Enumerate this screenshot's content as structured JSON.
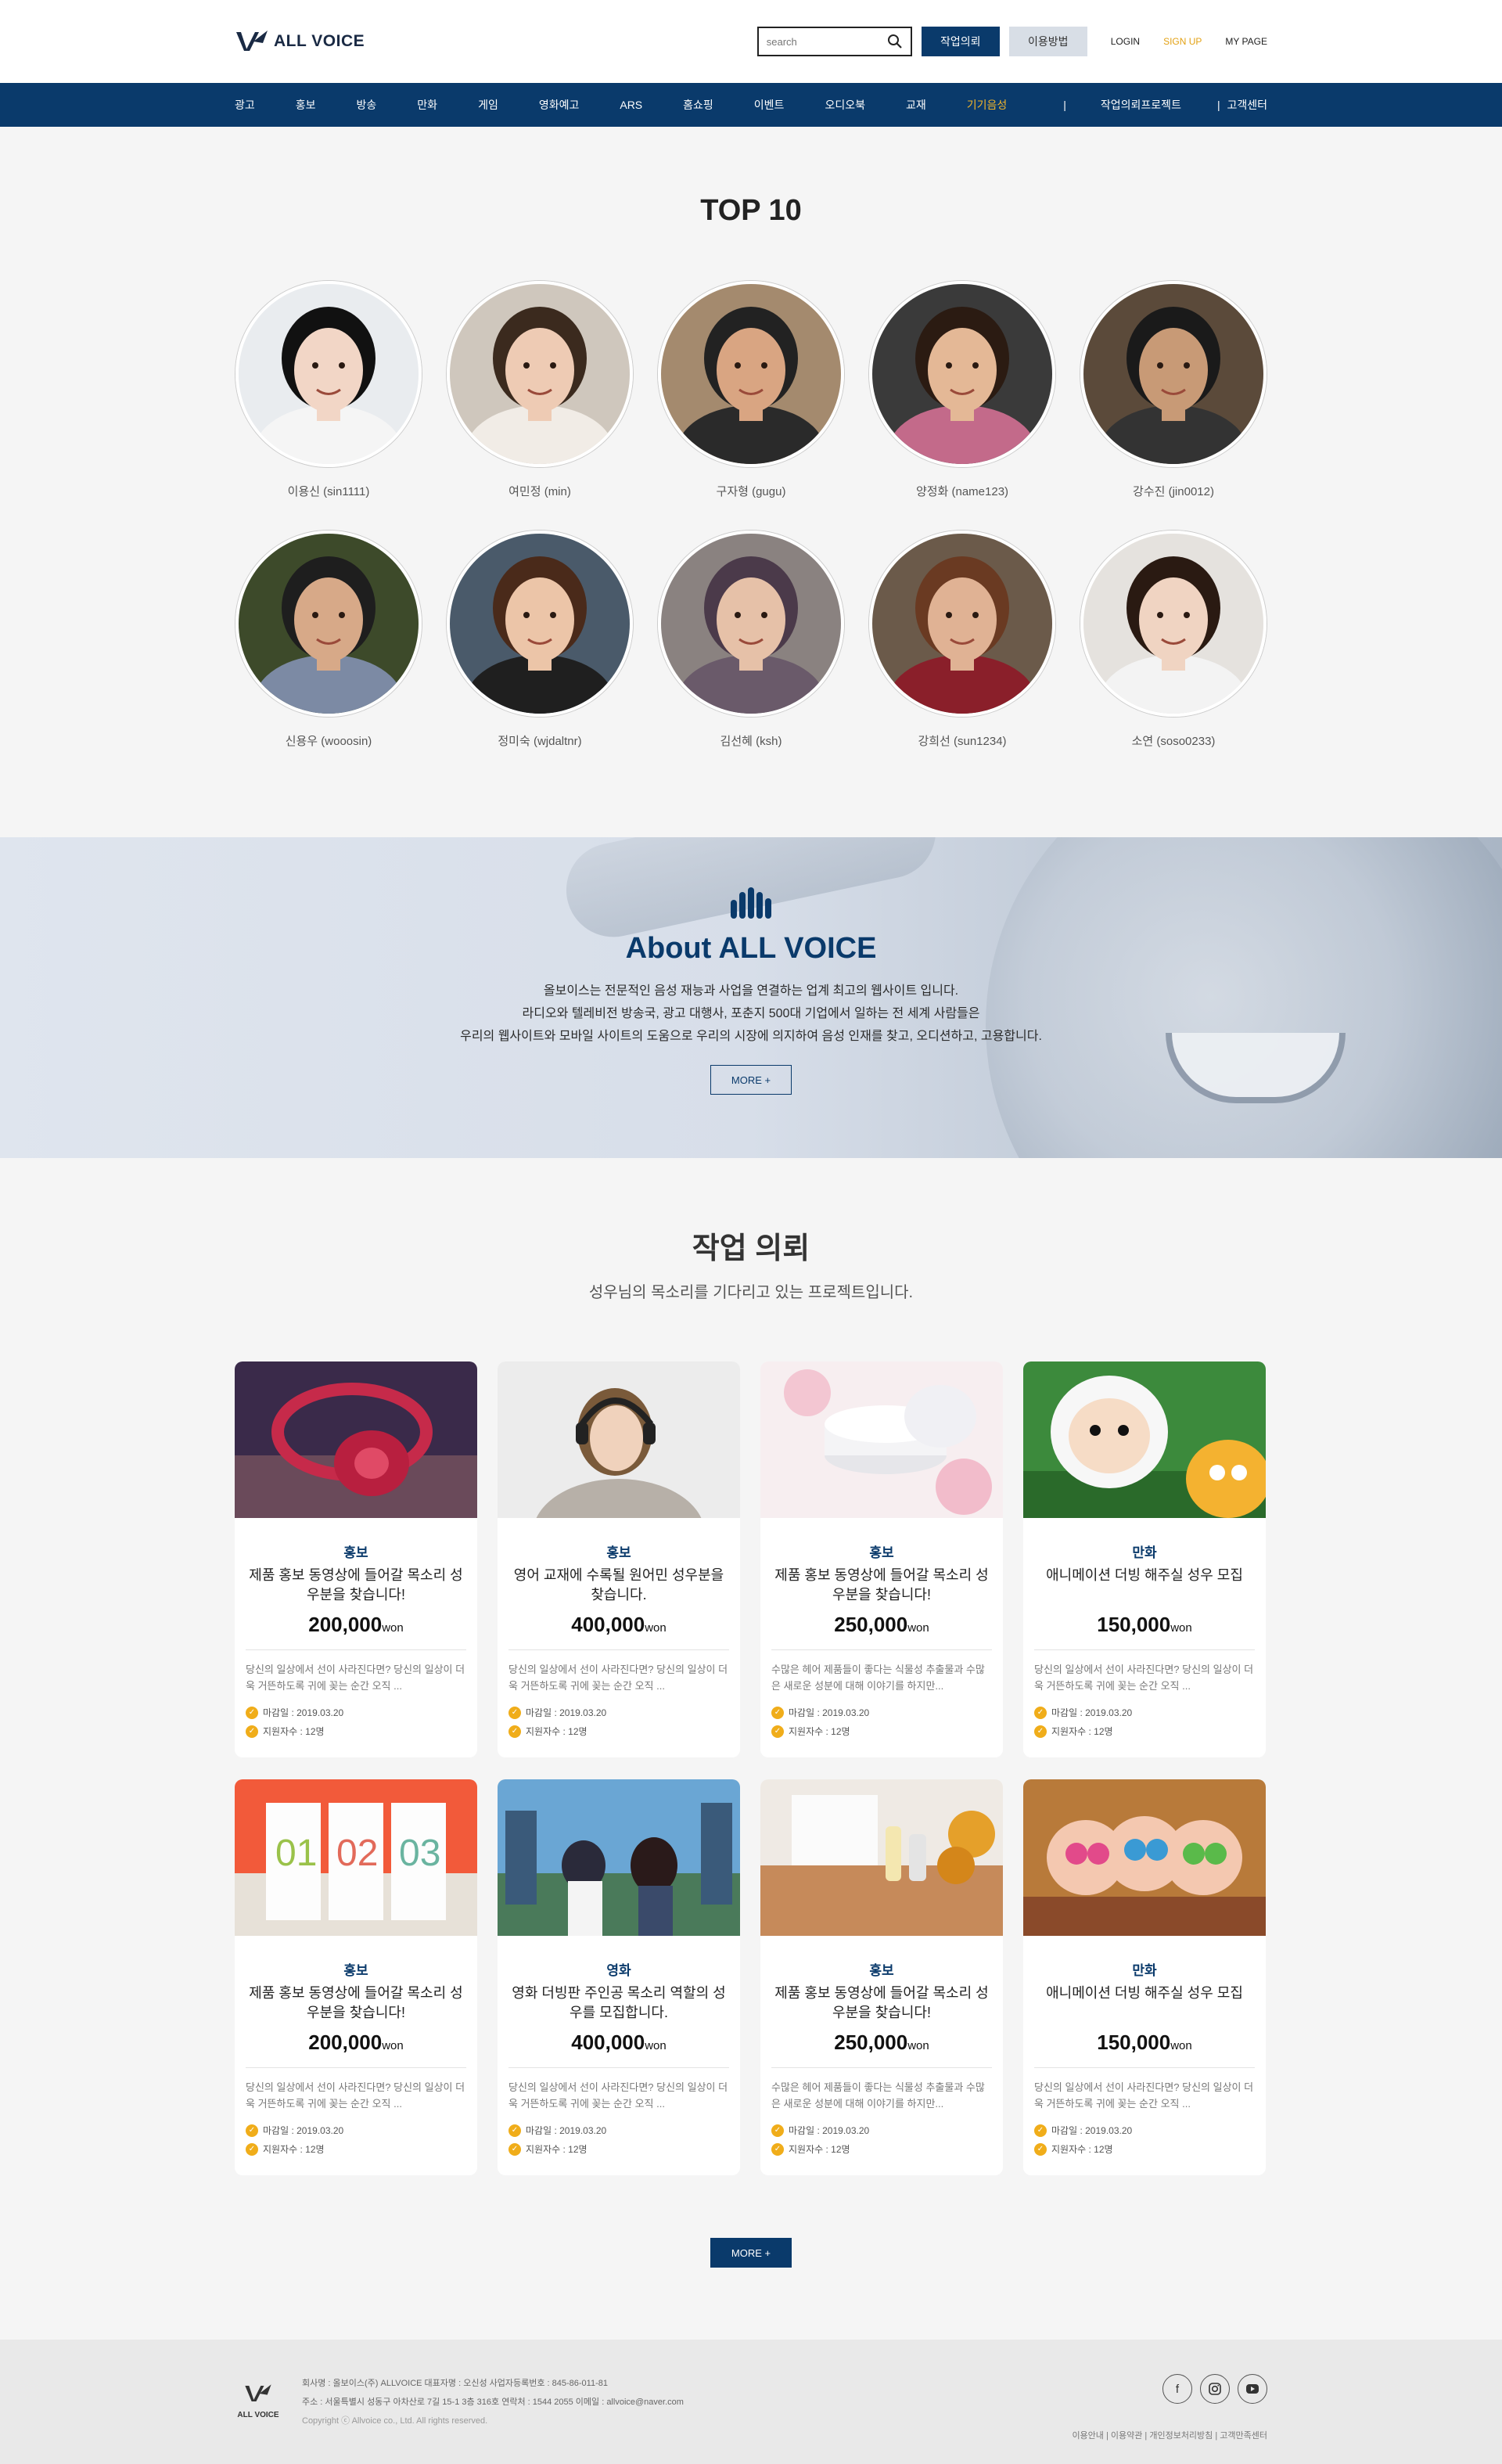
{
  "header": {
    "logo_text": "ALL VOICE",
    "search_placeholder": "search",
    "btn_request": "작업의뢰",
    "btn_usage": "이용방법",
    "util": {
      "login": "LOGIN",
      "signup": "SIGN UP",
      "mypage": "MY PAGE"
    }
  },
  "nav": {
    "items": [
      "광고",
      "홍보",
      "방송",
      "만화",
      "게임",
      "영화예고",
      "ARS",
      "홈쇼핑",
      "이벤트",
      "오디오북",
      "교재",
      "기기음성"
    ],
    "sep": "|",
    "project": "작업의뢰프로젝트",
    "support": "고객센터"
  },
  "top10": {
    "title": "TOP 10",
    "voices": [
      {
        "name": "이용신 (sin1111)"
      },
      {
        "name": "여민정 (min)"
      },
      {
        "name": "구자형 (gugu)"
      },
      {
        "name": "양정화 (name123)"
      },
      {
        "name": "강수진 (jin0012)"
      },
      {
        "name": "신용우 (wooosin)"
      },
      {
        "name": "정미숙 (wjdaltnr)"
      },
      {
        "name": "김선혜 (ksh)"
      },
      {
        "name": "강희선 (sun1234)"
      },
      {
        "name": "소연 (soso0233)"
      }
    ]
  },
  "about": {
    "title": "About ALL VOICE",
    "lines": [
      "올보이스는 전문적인 음성 재능과 사업을 연결하는 업계 최고의 웹사이트 입니다.",
      "라디오와 텔레비전 방송국, 광고 대행사, 포춘지 500대 기업에서 일하는 전 세계 사람들은",
      "우리의 웹사이트와 모바일 사이트의 도움으로 우리의 시장에 의지하여 음성 인재를 찾고, 오디션하고, 고용합니다."
    ],
    "more": "MORE +"
  },
  "jobs": {
    "title": "작업 의뢰",
    "subtitle": "성우님의 목소리를 기다리고 있는 프로젝트입니다.",
    "deadline_label": "마감일 : 2019.03.20",
    "applicants_label": "지원자수 : 12명",
    "won": "won",
    "items": [
      {
        "category": "홍보",
        "title": "제품 홍보 동영상에 들어갈 목소리 성우분을 찾습니다!",
        "price": "200,000",
        "desc": "당신의 일상에서 선이 사라진다면? 당신의 일상이 더욱 거뜬하도록 귀에 꽂는 순간 오직 ..."
      },
      {
        "category": "홍보",
        "title": "영어 교재에 수록될 원어민 성우분을 찾습니다.",
        "price": "400,000",
        "desc": "당신의 일상에서 선이 사라진다면? 당신의 일상이 더욱 거뜬하도록 귀에 꽂는 순간 오직 ..."
      },
      {
        "category": "홍보",
        "title": "제품 홍보 동영상에 들어갈 목소리 성우분을 찾습니다!",
        "price": "250,000",
        "desc": "수많은 헤어 제품들이 좋다는 식물성 추출물과 수많은 새로운 성분에 대해 이야기를 하지만..."
      },
      {
        "category": "만화",
        "title": "애니메이션 더빙 해주실 성우 모집",
        "price": "150,000",
        "desc": "당신의 일상에서 선이 사라진다면? 당신의 일상이 더욱 거뜬하도록 귀에 꽂는 순간 오직 ..."
      },
      {
        "category": "홍보",
        "title": "제품 홍보 동영상에 들어갈 목소리 성우분을 찾습니다!",
        "price": "200,000",
        "desc": "당신의 일상에서 선이 사라진다면? 당신의 일상이 더욱 거뜬하도록 귀에 꽂는 순간 오직 ..."
      },
      {
        "category": "영화",
        "title": "영화 더빙판 주인공 목소리 역할의 성우를 모집합니다.",
        "price": "400,000",
        "desc": "당신의 일상에서 선이 사라진다면? 당신의 일상이 더욱 거뜬하도록 귀에 꽂는 순간 오직 ..."
      },
      {
        "category": "홍보",
        "title": "제품 홍보 동영상에 들어갈 목소리 성우분을 찾습니다!",
        "price": "250,000",
        "desc": "수많은 헤어 제품들이 좋다는 식물성 추출물과 수많은 새로운 성분에 대해 이야기를 하지만..."
      },
      {
        "category": "만화",
        "title": "애니메이션 더빙 해주실 성우 모집",
        "price": "150,000",
        "desc": "당신의 일상에서 선이 사라진다면? 당신의 일상이 더욱 거뜬하도록 귀에 꽂는 순간 오직 ..."
      }
    ],
    "more": "MORE +"
  },
  "footer": {
    "logo_text": "ALL VOICE",
    "line1": "회사명 : 올보이스(주) ALLVOICE  대표자명 : 오신성  사업자등록번호 : 845-86-011-81",
    "line2": "주소 : 서울특별시 성동구 아차산로 7길 15-1 3층 316호  연락처 : 1544 2055  이메일 : allvoice@naver.com",
    "copyright": "Copyright ⓒ Allvoice co., Ltd. All rights reserved.",
    "links": "이용안내  |  이용약관  |  개인정보처리방침  |  고객만족센터"
  },
  "colors": {
    "primary": "#0a3a6b",
    "accent": "#f3b62a",
    "signup": "#e3a113",
    "check": "#f0ad1a"
  }
}
